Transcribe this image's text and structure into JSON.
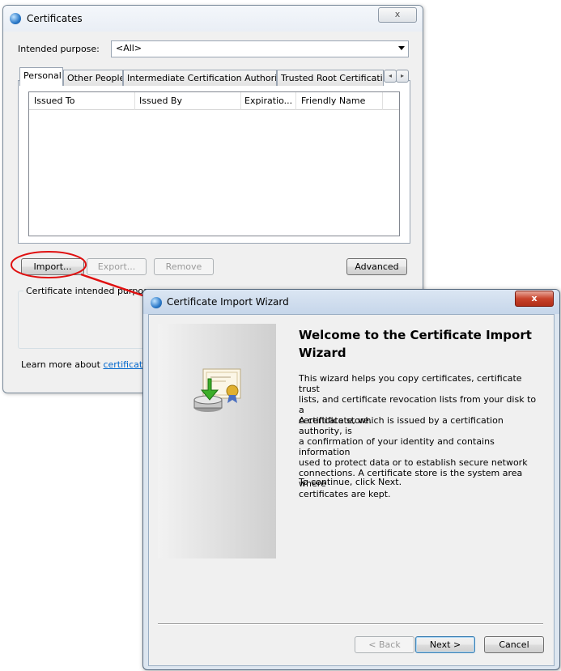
{
  "certificates_window": {
    "title": "Certificates",
    "close_glyph": "x",
    "intended_purpose_label": "Intended purpose:",
    "intended_purpose_value": "<All>",
    "tabs": [
      {
        "label": "Personal"
      },
      {
        "label": "Other People"
      },
      {
        "label": "Intermediate Certification Authorities"
      },
      {
        "label": "Trusted Root Certification"
      }
    ],
    "tab_scroll": {
      "left": "◂",
      "right": "▸"
    },
    "columns": [
      "Issued To",
      "Issued By",
      "Expiratio...",
      "Friendly Name"
    ],
    "buttons": {
      "import": "Import...",
      "export": "Export...",
      "remove": "Remove",
      "advanced": "Advanced"
    },
    "purposes_group_label": "Certificate intended purposes",
    "learn_more_text": "Learn more about ",
    "learn_more_link": "certificates"
  },
  "annotation": {
    "color": "#e01010"
  },
  "wizard": {
    "title": "Certificate Import Wizard",
    "close_glyph": "x",
    "heading_line1": "Welcome to the Certificate Import",
    "heading_line2": "Wizard",
    "para1_lines": [
      "This wizard helps you copy certificates, certificate trust",
      "lists, and certificate revocation lists from your disk to a",
      "certificate store."
    ],
    "para2_lines": [
      "A certificate, which is issued by a certification authority, is",
      "a confirmation of your identity and contains information",
      "used to protect data or to establish secure network",
      "connections. A certificate store is the system area where",
      "certificates are kept."
    ],
    "para3": "To continue, click Next.",
    "buttons": {
      "back": "< Back",
      "next": "Next >",
      "cancel": "Cancel"
    },
    "side_icon": "certificate-import-icon"
  }
}
